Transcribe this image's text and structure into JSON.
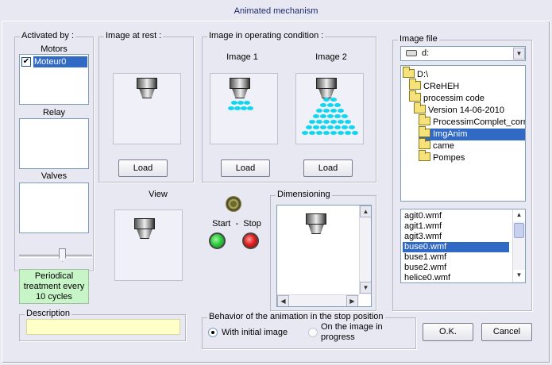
{
  "window": {
    "title": "Animated mechanism"
  },
  "activated_by": {
    "label": "Activated by :",
    "motors_label": "Motors",
    "motors": [
      {
        "name": "Moteur0",
        "checked": true
      }
    ],
    "relays_label": "Relay",
    "valves_label": "Valves"
  },
  "periodical": {
    "text": "Periodical treatment every 10 cycles"
  },
  "description": {
    "label": "Description",
    "value": ""
  },
  "image_rest": {
    "label": "Image at rest :",
    "load_label": "Load"
  },
  "image_operating": {
    "label": "Image in operating condition :",
    "image1_label": "Image 1",
    "image2_label": "Image 2",
    "load_label": "Load"
  },
  "view": {
    "label": "View"
  },
  "start_stop": {
    "label": "Start  -  Stop"
  },
  "dimensioning": {
    "label": "Dimensioning"
  },
  "behavior": {
    "label": "Behavior of the animation in the stop position",
    "option1": "With initial image",
    "option2": "On the image in progress",
    "selected": "option1"
  },
  "image_file": {
    "label": "Image file",
    "drive": "d:",
    "tree": [
      "D:\\",
      "CReHEH",
      "processim code",
      "Version 14-06-2010",
      "ProcessimComplet_corrige",
      "ImgAnim",
      "came",
      "Pompes"
    ],
    "tree_selected": "ImgAnim",
    "files": [
      "agit0.wmf",
      "agit1.wmf",
      "agit3.wmf",
      "buse0.wmf",
      "buse1.wmf",
      "buse2.wmf",
      "helice0.wmf"
    ],
    "file_selected": "buse0.wmf"
  },
  "buttons": {
    "ok": "O.K.",
    "cancel": "Cancel"
  },
  "colors": {
    "selection": "#316ac5",
    "spray": "#12d6f0",
    "start": "#2ecc40",
    "stop": "#e02020",
    "periodical_bg": "#c8f5c8",
    "description_bg": "#ffffc8"
  }
}
